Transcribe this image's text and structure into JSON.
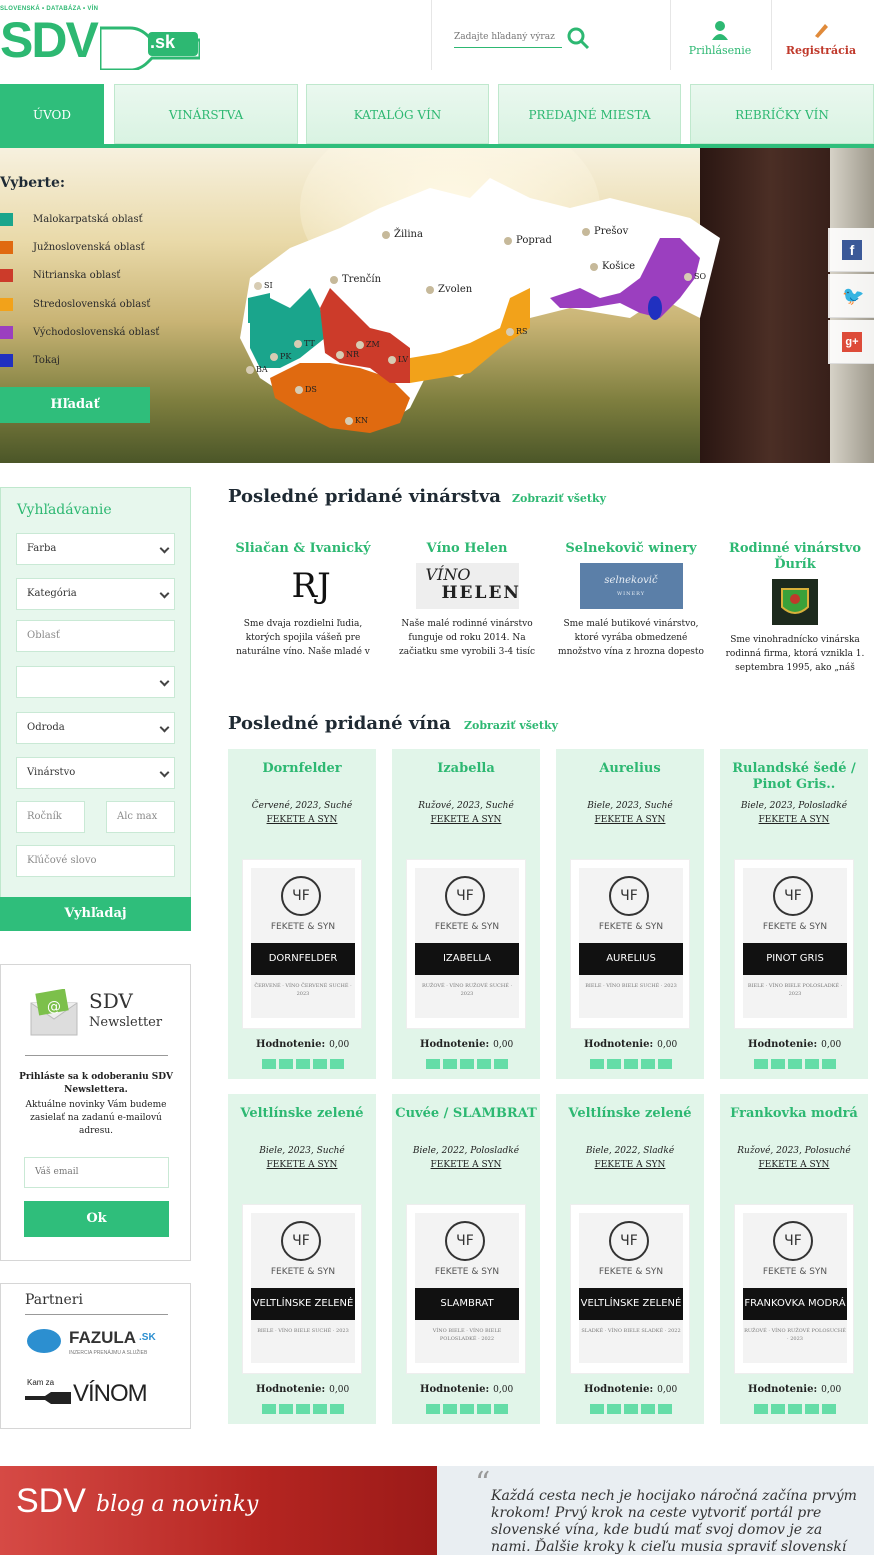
{
  "header": {
    "logo_tagline": "SLOVENSKÁ • DATABÁZA • VÍN",
    "logo_text": "SDV",
    "logo_suffix": ".sk",
    "search_placeholder": "Zadajte hľadaný výraz",
    "login_label": "Prihlásenie",
    "register_label": "Registrácia",
    "colors": {
      "brand": "#2db872",
      "register": "#c0392b"
    }
  },
  "nav": {
    "tabs": [
      {
        "label": "ÚVOD",
        "active": true
      },
      {
        "label": "VINÁRSTVA"
      },
      {
        "label": "KATALÓG VÍN"
      },
      {
        "label": "PREDAJNÉ MIESTA"
      },
      {
        "label": "REBRÍČKY VÍN"
      }
    ]
  },
  "hero": {
    "legend_title": "Vyberte:",
    "regions": [
      {
        "label": "Malokarpatská oblasť",
        "color": "#1aa58c"
      },
      {
        "label": "Južnoslovenská oblasť",
        "color": "#e06a10"
      },
      {
        "label": "Nitrianska oblasť",
        "color": "#cc3b2a"
      },
      {
        "label": "Stredoslovenská oblasť",
        "color": "#f2a21a"
      },
      {
        "label": "Východoslovenská oblasť",
        "color": "#9b3fbf"
      },
      {
        "label": "Tokaj",
        "color": "#2030c0"
      }
    ],
    "search_button": "Hľadať",
    "cities": [
      "Žilina",
      "Poprad",
      "Prešov",
      "Košice",
      "Trenčín",
      "Zvolen"
    ],
    "abbreviations": [
      "SI",
      "TT",
      "ZM",
      "NR",
      "PK",
      "LV",
      "BA",
      "DS",
      "KN",
      "RS",
      "SO"
    ],
    "social": [
      "facebook-icon",
      "twitter-icon",
      "google-plus-icon"
    ]
  },
  "sidebar": {
    "search_title": "Vyhľadávanie",
    "fields": {
      "farba": "Farba",
      "kategoria": "Kategória",
      "oblast": "Oblasť",
      "empty": "",
      "odroda": "Odroda",
      "vinarstvo": "Vinárstvo",
      "rocnik": "Ročník",
      "alc_max": "Alc max",
      "klucove": "Kľúčové slovo"
    },
    "search_button": "Vyhľadaj",
    "newsletter": {
      "title": "SDV",
      "subtitle": "Newsletter",
      "bold_text": "Prihláste sa k odoberaniu SDV Newslettera.",
      "text": "Aktuálne novinky Vám budeme zasielať na zadanú e-mailovú adresu.",
      "email_placeholder": "Váš email",
      "button": "Ok"
    },
    "partners": {
      "title": "Partneri",
      "fazula_name": "FAZULA",
      "fazula_suffix": ".SK",
      "fazula_tag": "INZERCIA PRENÁJMU A SLUŽIEB",
      "vinom_prefix": "Kam za",
      "vinom_name": "VÍNOM"
    }
  },
  "wineries_section": {
    "title": "Posledné pridané vinárstva",
    "show_all": "Zobraziť všetky",
    "items": [
      {
        "name": "Sliačan & Ivanický",
        "desc": "Sme dvaja rozdielni ľudia, ktorých spojila vášeň pre naturálne víno. Naše mladé v"
      },
      {
        "name": "Víno Helen",
        "desc": "Naše malé rodinné vinárstvo funguje od roku 2014. Na začiatku sme vyrobili 3-4 tisíc"
      },
      {
        "name": "Selnekovič winery",
        "desc": "Sme malé butikové vinárstvo, ktoré vyrába obmedzené množstvo vína z hrozna dopesto"
      },
      {
        "name": "Rodinné vinárstvo Ďurík",
        "desc": "Sme vinohradnícko vinárska rodinná firma, ktorá vznikla 1. septembra 1995, ako „náš"
      }
    ],
    "logo_texts": {
      "rj": "RJ",
      "helen_top": "VÍNO",
      "helen_bottom": "HELEN",
      "selnekovic": "selnekovič",
      "selnekovic_sub": "WINERY"
    }
  },
  "wines_section": {
    "title": "Posledné pridané vína",
    "show_all": "Zobraziť všetky",
    "rating_label": "Hodnotenie:",
    "label_brand": "FEKETE & SYN",
    "items": [
      {
        "name": "Dornfelder",
        "meta": "Červené, 2023, Suché",
        "producer": "FEKETE A SYN",
        "rating": "0,00",
        "band": "DORNFELDER",
        "tiny": "ČERVENÉ · VÍNO ČERVENÉ SUCHÉ · 2023"
      },
      {
        "name": "Izabella",
        "meta": "Ružové, 2023, Suché",
        "producer": "FEKETE A SYN",
        "rating": "0,00",
        "band": "IZABELLA",
        "tiny": "RUŽOVÉ · VÍNO RUŽOVÉ SUCHÉ · 2023"
      },
      {
        "name": "Aurelius",
        "meta": "Biele, 2023, Suché",
        "producer": "FEKETE A SYN",
        "rating": "0,00",
        "band": "AURELIUS",
        "tiny": "BIELE · VÍNO BIELE SUCHÉ · 2023"
      },
      {
        "name": "Rulandské šedé / Pinot Gris..",
        "meta": "Biele, 2023, Polosladké",
        "producer": "FEKETE A SYN",
        "rating": "0,00",
        "band": "PINOT GRIS",
        "tiny": "BIELE · VÍNO BIELE POLOSLADKÉ · 2023"
      },
      {
        "name": "Veltlínske zelené",
        "meta": "Biele, 2023, Suché",
        "producer": "FEKETE A SYN",
        "rating": "0,00",
        "band": "VELTLÍNSKE ZELENÉ",
        "tiny": "BIELE · VÍNO BIELE SUCHÉ · 2023"
      },
      {
        "name": "Cuvée / SLAMBRAT",
        "meta": "Biele, 2022, Polosladké",
        "producer": "FEKETE A SYN",
        "rating": "0,00",
        "band": "SLAMBRAT",
        "tiny": "VÍNO BIELE · VÍNO BIELE POLOSLADKÉ · 2022"
      },
      {
        "name": "Veltlínske zelené",
        "meta": "Biele, 2022, Sladké",
        "producer": "FEKETE A SYN",
        "rating": "0,00",
        "band": "VELTLÍNSKE ZELENÉ",
        "tiny": "SLADKÉ · VÍNO BIELE SLADKÉ · 2022"
      },
      {
        "name": "Frankovka modrá",
        "meta": "Ružové, 2023, Polosuché",
        "producer": "FEKETE A SYN",
        "rating": "0,00",
        "band": "FRANKOVKA MODRÁ",
        "tiny": "RUŽOVÉ · VÍNO RUŽOVÉ POLOSUCHÉ · 2023"
      }
    ]
  },
  "footer": {
    "blog_title": "SDV",
    "blog_subtitle": "blog a novinky",
    "quote": "Každá cesta nech je hocijako náročná začína prvým krokom! Prvý krok na ceste vytvoriť portál pre slovenské vína, kde budú mať svoj domov je za nami. Ďalšie kroky k cieľu musia spraviť slovenskí vinári"
  }
}
